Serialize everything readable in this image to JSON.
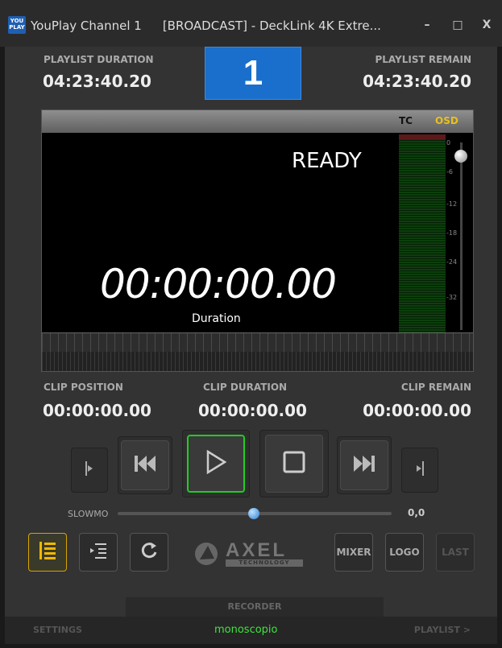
{
  "window": {
    "icon_text": "YOU PLAY",
    "title_channel": "YouPlay Channel 1",
    "title_device": "[BROADCAST] - DeckLink 4K Extre...",
    "minimize": "–",
    "maximize": "□",
    "close": "X"
  },
  "header": {
    "playlist_duration_label": "PLAYLIST DURATION",
    "playlist_duration_value": "04:23:40.20",
    "channel_number": "1",
    "playlist_remain_label": "PLAYLIST REMAIN",
    "playlist_remain_value": "04:23:40.20"
  },
  "player": {
    "tc_label": "TC",
    "osd_label": "OSD",
    "status": "READY",
    "timecode": "00:00:00.00",
    "timecode_label": "Duration",
    "db_ticks": [
      "0",
      "-6",
      "-12",
      "-18",
      "-24",
      "-32"
    ]
  },
  "clip": {
    "position_label": "CLIP POSITION",
    "position_value": "00:00:00.00",
    "duration_label": "CLIP DURATION",
    "duration_value": "00:00:00.00",
    "remain_label": "CLIP REMAIN",
    "remain_value": "00:00:00.00"
  },
  "transport": {
    "icons": [
      "mark-in-icon",
      "previous-icon",
      "play-icon",
      "stop-icon",
      "next-icon",
      "mark-out-icon"
    ],
    "play_color": "#22cc22"
  },
  "slowmo": {
    "label": "SLOWMO",
    "value": "0,0"
  },
  "tools": {
    "mixer_label": "MIXER",
    "logo_label": "LOGO",
    "last_label": "LAST",
    "brand_name": "AXEL",
    "brand_sub": "TECHNOLOGY"
  },
  "footer": {
    "recorder_label": "RECORDER",
    "settings_label": "SETTINGS",
    "current_item": "monoscopio",
    "playlist_label": "PLAYLIST >"
  },
  "colors": {
    "accent_blue": "#1a6fcc",
    "active_yellow": "#f0b800",
    "osd_yellow": "#e8c020",
    "status_green": "#3fe33f"
  }
}
